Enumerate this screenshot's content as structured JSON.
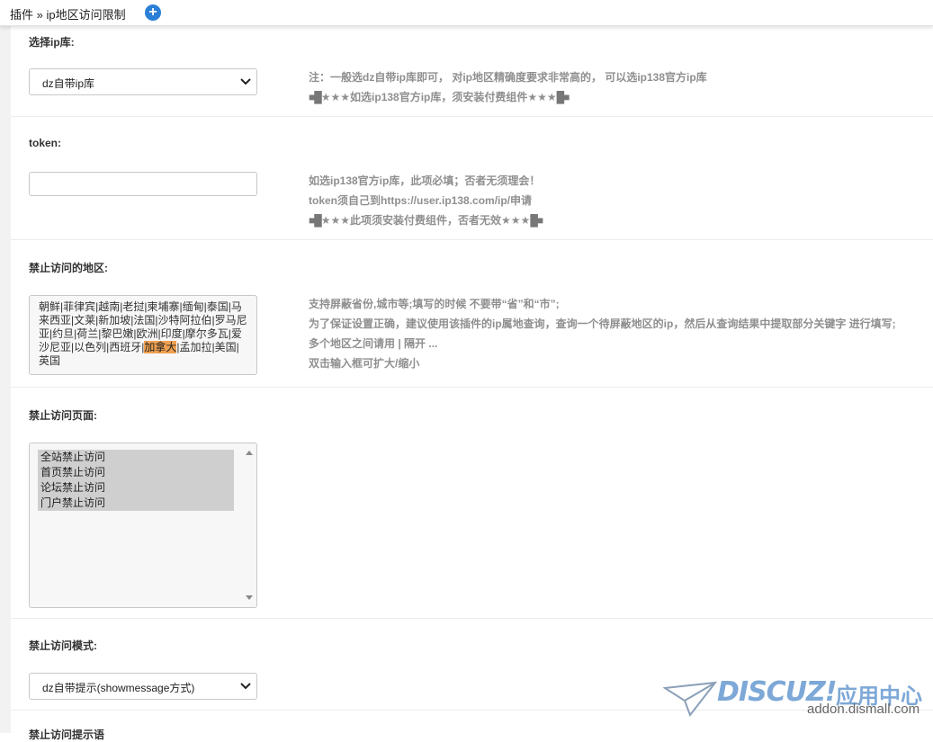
{
  "header": {
    "breadcrumb": "插件 » ip地区访问限制",
    "add_icon": "+"
  },
  "ip_lib": {
    "label": "选择ip库:",
    "value": "dz自带ip库",
    "note1": "注：一般选dz自带ip库即可，  对ip地区精确度要求非常高的，  可以选ip138官方ip库",
    "note2_blocks_left": "■█",
    "note2_text": "★★★如选ip138官方ip库，须安装付费组件★★★",
    "note2_blocks_right": "█■"
  },
  "token": {
    "label": "token:",
    "value": "",
    "note1": "如选ip138官方ip库，此项必填；否者无须理会！",
    "note2": "token须自己到https://user.ip138.com/ip/申请",
    "note3_blocks_left": "■█",
    "note3_text": "★★★此项须安装付费组件，否者无效★★★",
    "note3_blocks_right": "█■"
  },
  "regions": {
    "label": "禁止访问的地区:",
    "text_before": "朝鲜|菲律宾|越南|老挝|柬埔寨|缅甸|泰国|马来西亚|文莱|新加坡|法国|沙特阿拉伯|罗马尼亚|约旦|荷兰|黎巴嫩|欧洲|印度|摩尔多瓦|爱沙尼亚|以色列|西班牙|",
    "text_highlight": "加拿大",
    "text_after": "|孟加拉|美国|英国",
    "note1": "支持屏蔽省份,城市等;填写的时候 不要带“省”和“市”;",
    "note2": "为了保证设置正确，建议使用该插件的ip属地查询，查询一个待屏蔽地区的ip，然后从查询结果中提取部分关键字 进行填写;",
    "note3": "多个地区之间请用 | 隔开 ...",
    "note4": "双击输入框可扩大/缩小"
  },
  "pages": {
    "label": "禁止访问页面:",
    "options": [
      "全站禁止访问",
      "首页禁止访问",
      "论坛禁止访问",
      "门户禁止访问"
    ]
  },
  "mode": {
    "label": "禁止访问模式:",
    "value": "dz自带提示(showmessage方式)"
  },
  "next_label": "禁止访问提示语",
  "watermark": {
    "brand": "DISCUZ!",
    "cn": "应用中心",
    "url": "addon.dismall.com"
  },
  "colors": {
    "accent": "#2b7fd6",
    "highlight": "#f0a050",
    "note": "#8f8f8f"
  }
}
